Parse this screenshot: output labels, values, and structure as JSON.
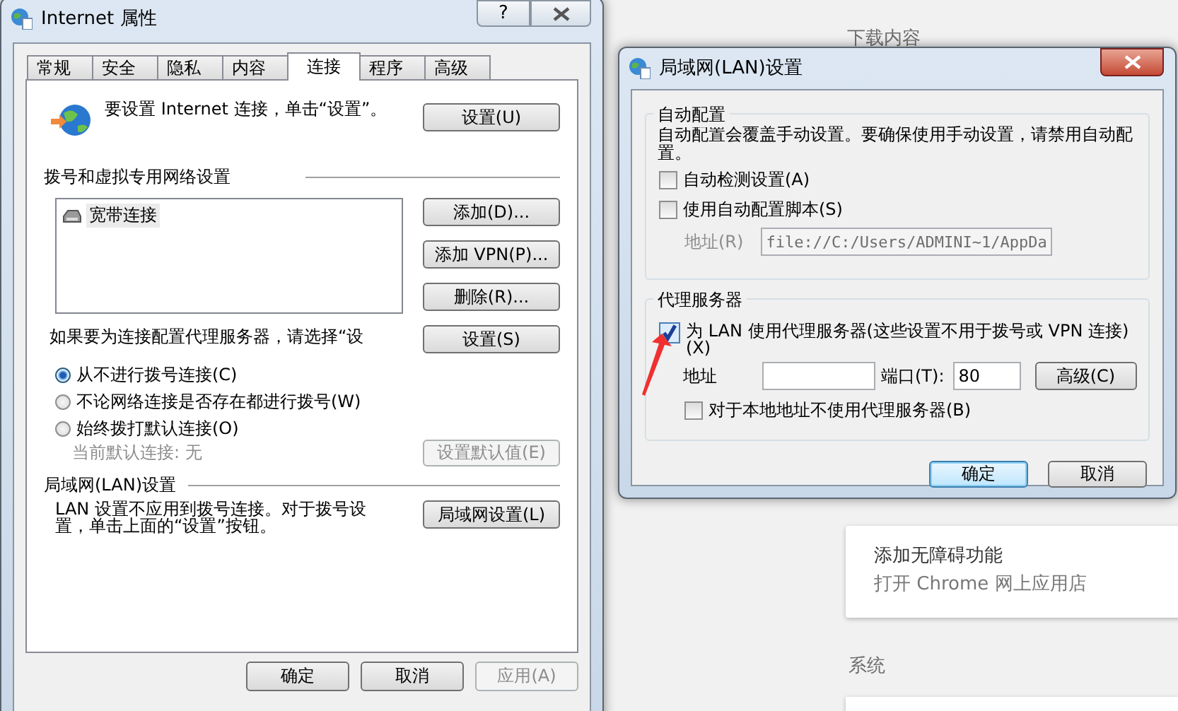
{
  "background": {
    "section_heading": "下载内容",
    "card_lines": [
      "添加无障碍功能",
      "打开 Chrome 网上应用店"
    ],
    "section_heading_2": "系统"
  },
  "internet_options": {
    "title": "Internet 属性",
    "help_button": "?",
    "tabs": [
      {
        "label": "常规",
        "selected": false
      },
      {
        "label": "安全",
        "selected": false
      },
      {
        "label": "隐私",
        "selected": false
      },
      {
        "label": "内容",
        "selected": false
      },
      {
        "label": "连接",
        "selected": true
      },
      {
        "label": "程序",
        "selected": false
      },
      {
        "label": "高级",
        "selected": false
      }
    ],
    "setup_text": "要设置 Internet 连接，单击“设置”。",
    "setup_button": "设置(U)",
    "dialup_heading": "拨号和虚拟专用网络设置",
    "connections": [
      {
        "name": "宽带连接",
        "selected": true
      }
    ],
    "connection_buttons": [
      "添加(D)...",
      "添加 VPN(P)...",
      "删除(R)..."
    ],
    "proxy_text": "如果要为连接配置代理服务器，请选择“设",
    "proxy_button": "设置(S)",
    "dial_options": [
      {
        "label": "从不进行拨号连接(C)",
        "selected": true
      },
      {
        "label": "不论网络连接是否存在都进行拨号(W)",
        "selected": false
      },
      {
        "label": "始终拨打默认连接(O)",
        "selected": false
      }
    ],
    "current_default": "当前默认连接: 无",
    "set_default_button": {
      "label": "设置默认值(E)",
      "disabled": true
    },
    "lan_heading": "局域网(LAN)设置",
    "lan_text": "LAN 设置不应用到拨号连接。对于拨号设置，单击上面的“设置”按钮。",
    "lan_button": "局域网设置(L)",
    "footer_buttons": [
      {
        "label": "确定",
        "disabled": false
      },
      {
        "label": "取消",
        "disabled": false
      },
      {
        "label": "应用(A)",
        "disabled": true
      }
    ]
  },
  "lan_dialog": {
    "title": "局域网(LAN)设置",
    "auto_heading": "自动配置",
    "auto_text": "自动配置会覆盖手动设置。要确保使用手动设置，请禁用自动配置。",
    "auto_checkboxes": [
      {
        "label": "自动检测设置(A)",
        "checked": false
      },
      {
        "label": "使用自动配置脚本(S)",
        "checked": false
      }
    ],
    "script_address_label": "地址(R)",
    "script_address_value": "file://C:/Users/ADMINI~1/AppDa",
    "script_address_disabled": true,
    "proxy_heading": "代理服务器",
    "use_proxy": {
      "label": "为 LAN 使用代理服务器(这些设置不用于拨号或 VPN 连接)(X)",
      "checked": true
    },
    "address_label": "地址",
    "port_label": "端口(T):",
    "port_value": "80",
    "advanced_button": "高级(C)",
    "bypass": {
      "label": "对于本地地址不使用代理服务器(B)",
      "checked": false
    },
    "buttons": [
      {
        "label": "确定",
        "default": true
      },
      {
        "label": "取消",
        "default": false
      }
    ]
  }
}
